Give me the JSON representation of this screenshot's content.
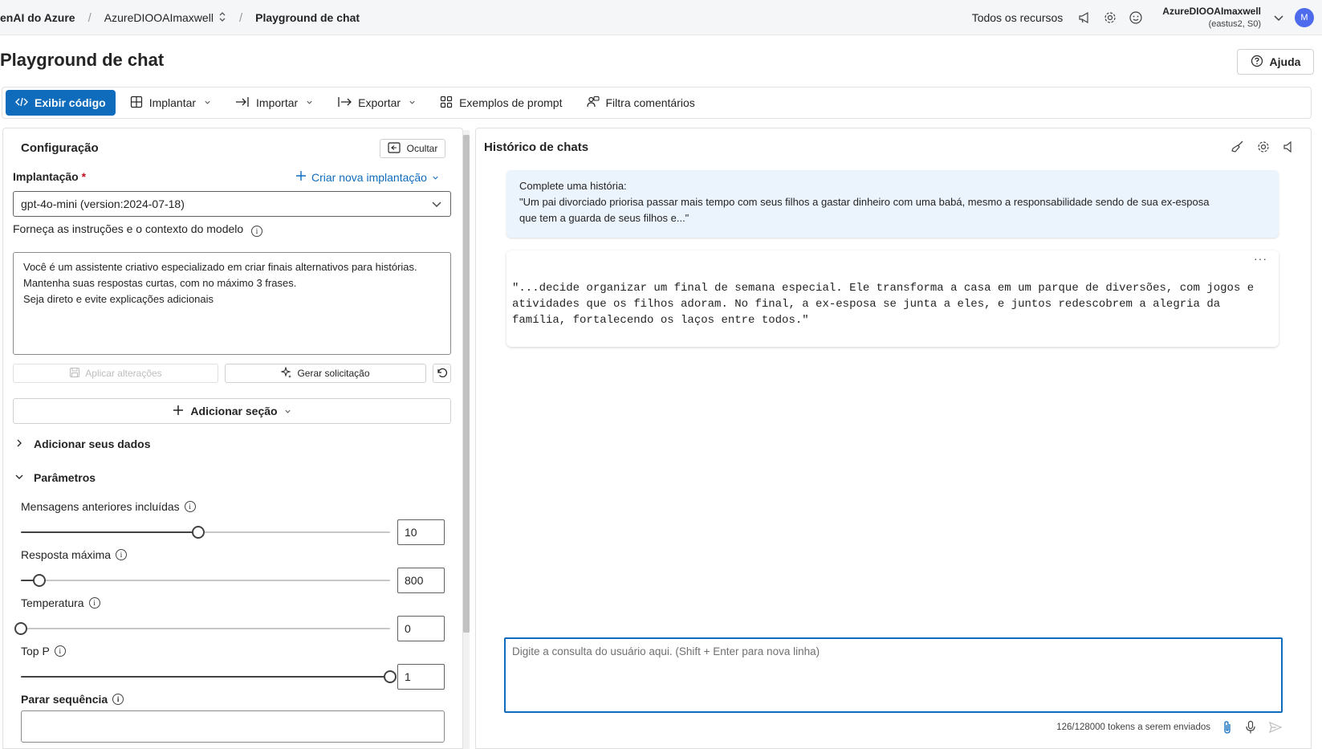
{
  "breadcrumb": {
    "service": "enAI do Azure",
    "resource": "AzureDIOOAImaxwell",
    "current": "Playground de chat"
  },
  "topbar": {
    "all_resources": "Todos os recursos",
    "user_name": "AzureDIOOAImaxwell",
    "user_region": "(eastus2, S0)",
    "avatar_initial": "M"
  },
  "page": {
    "title": "Playground de chat",
    "help_label": "Ajuda"
  },
  "toolbar": {
    "view_code": "Exibir código",
    "deploy": "Implantar",
    "import": "Importar",
    "export": "Exportar",
    "prompt_examples": "Exemplos de prompt",
    "feedback": "Filtra comentários"
  },
  "config": {
    "title": "Configuração",
    "hide_label": "Ocultar",
    "deployment_label": "Implantação",
    "required_mark": "*",
    "create_deployment": "Criar nova implantação",
    "deployment_value": "gpt-4o-mini (version:2024-07-18)",
    "instructions_label": "Forneça as instruções e o contexto do modelo",
    "instructions_lines": [
      "Você é um assistente criativo especializado em criar finais alternativos para histórias.",
      "Mantenha suas respostas curtas, com no máximo 3 frases.",
      "Seja direto e evite explicações adicionais"
    ],
    "apply_changes": "Aplicar alterações",
    "generate_prompt": "Gerar solicitação",
    "add_section": "Adicionar seção",
    "add_data": "Adicionar seus dados",
    "parameters": "Parâmetros"
  },
  "parameters": {
    "past_messages": {
      "label": "Mensagens anteriores incluídas",
      "value": "10",
      "level": 0.48
    },
    "max_response": {
      "label": "Resposta máxima",
      "value": "800",
      "level": 0.05
    },
    "temperature": {
      "label": "Temperatura",
      "value": "0",
      "level": 0.0
    },
    "top_p": {
      "label": "Top P",
      "value": "1",
      "level": 1.0
    },
    "stop_sequence": {
      "label": "Parar sequência"
    }
  },
  "chat": {
    "title": "Histórico de chats",
    "user_message_lines": [
      "Complete uma história:",
      "\"Um pai divorciado priorisa passar mais tempo com seus filhos a gastar dinheiro com uma babá, mesmo a responsabilidade sendo de sua ex-esposa",
      "que tem a guarda de seus filhos e...\""
    ],
    "more_label": "···",
    "assistant_lines": [
      "\"...decide organizar um final de semana especial. Ele transforma a casa em um parque de diversões, com jogos e",
      "atividades que os filhos adoram. No final, a ex-esposa se junta a eles, e juntos redescobrem a alegria da",
      "família, fortalecendo os laços entre todos.\""
    ],
    "query_placeholder": "Digite a consulta do usuário aqui. (Shift + Enter para nova linha)",
    "token_count": "126/128000 tokens a serem enviados"
  },
  "icons": {
    "code": "code-icon",
    "deploy": "deploy-grid-icon",
    "import": "import-arrow-icon",
    "export": "export-arrow-icon",
    "examples": "grid-icon",
    "feedback": "people-feedback-icon",
    "help": "question-circle-icon",
    "clear": "broom-icon",
    "settings": "gear-icon",
    "speaker": "speaker-icon",
    "attach": "paperclip-icon",
    "mic": "microphone-icon",
    "send": "send-icon"
  },
  "colors": {
    "accent": "#0f6cbd",
    "avatar": "#4f6bed",
    "user_bubble": "#ebf3fc",
    "required": "#c50f1f"
  }
}
